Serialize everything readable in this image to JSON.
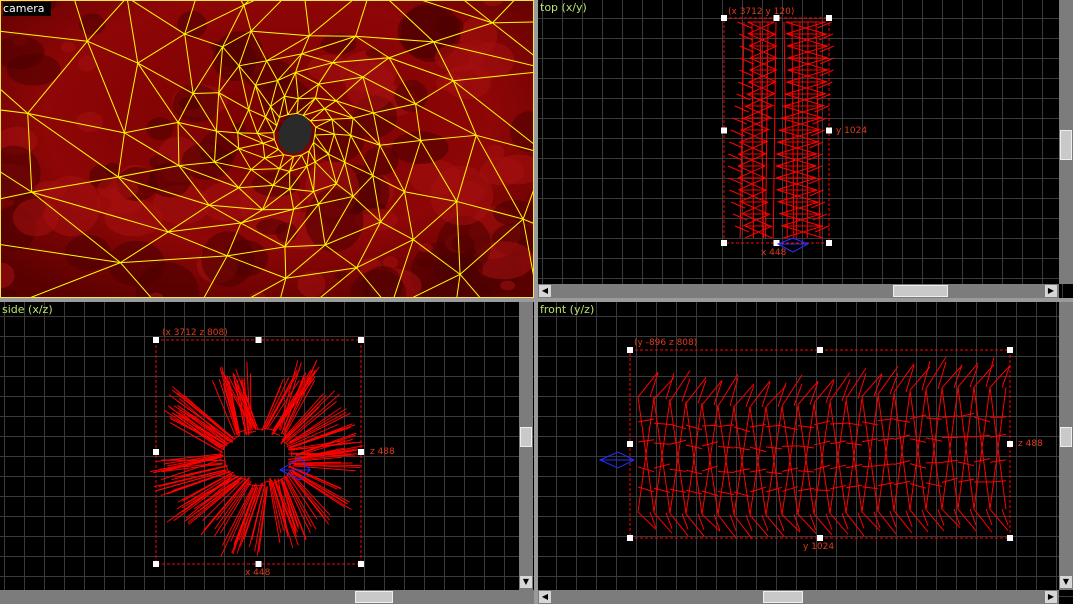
{
  "viewports": {
    "camera": {
      "title": "camera"
    },
    "top": {
      "title": "top (x/y)",
      "origin_label": "(x 3712 y 120)",
      "x_label": "x 448",
      "y_label": "y 1024"
    },
    "side": {
      "title": "side (x/z)",
      "origin_label": "(x 3712 z 808)",
      "x_label": "x 448",
      "z_label": "z 488"
    },
    "front": {
      "title": "front (y/z)",
      "origin_label": "(y -896 z 808)",
      "y_label": "y 1024",
      "z_label": "z 488"
    }
  },
  "colors": {
    "grid": "#3a3a3a",
    "geometry": "#ff0000",
    "wire": "#ffff00",
    "entity": "#2030ff",
    "label": "#e03a1a",
    "title": "#b9e36b"
  }
}
